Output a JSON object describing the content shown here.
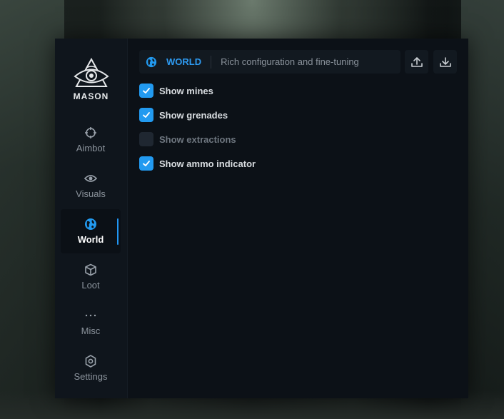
{
  "brand": {
    "name": "MASON"
  },
  "nav": [
    {
      "label": "Aimbot",
      "icon": "crosshair-icon",
      "active": false
    },
    {
      "label": "Visuals",
      "icon": "eye-icon",
      "active": false
    },
    {
      "label": "World",
      "icon": "globe-icon",
      "active": true
    },
    {
      "label": "Loot",
      "icon": "box-icon",
      "active": false
    },
    {
      "label": "Misc",
      "icon": "more-dots-icon",
      "active": false
    },
    {
      "label": "Settings",
      "icon": "gear-icon",
      "active": false
    }
  ],
  "header": {
    "title": "WORLD",
    "description": "Rich configuration and fine-tuning",
    "upload_icon": "upload-icon",
    "download_icon": "download-icon"
  },
  "options": [
    {
      "label": "Show mines",
      "checked": true
    },
    {
      "label": "Show grenades",
      "checked": true
    },
    {
      "label": "Show extractions",
      "checked": false
    },
    {
      "label": "Show ammo indicator",
      "checked": true
    }
  ],
  "colors": {
    "accent": "#229af0",
    "panel": "#0c1117",
    "sidebar": "#0f151c"
  }
}
